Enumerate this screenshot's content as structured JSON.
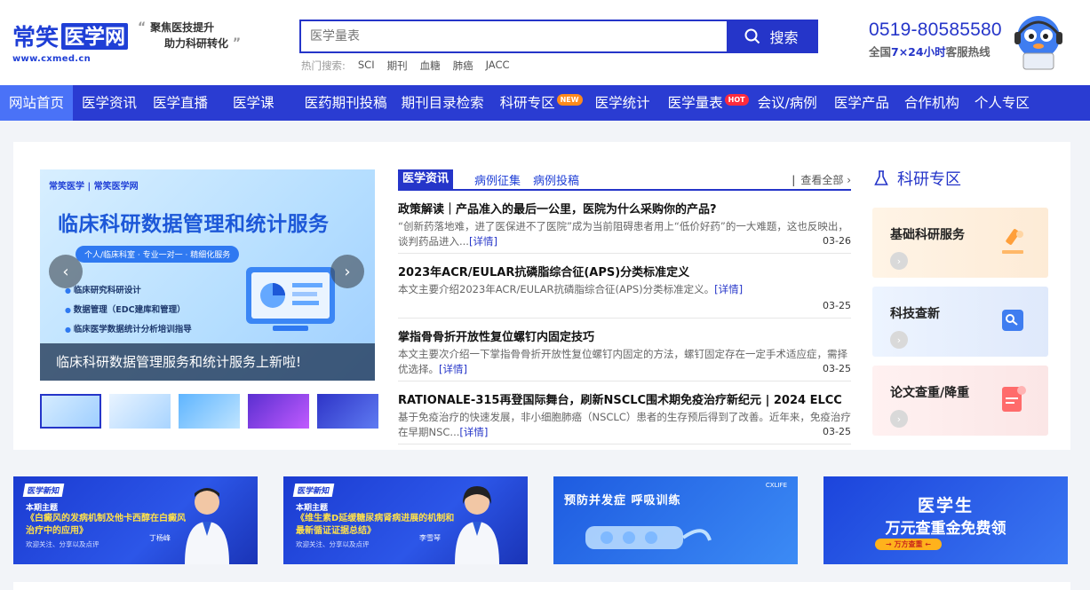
{
  "header": {
    "logo_text_a": "常笑",
    "logo_text_b": "医学网",
    "logo_url": "www.cxmed.cn",
    "slogan_line1": "聚焦医技提升",
    "slogan_line2": "助力科研转化",
    "search_placeholder": "医学量表",
    "search_button": "搜索",
    "hot_label": "热门搜索:",
    "hot_keywords": [
      "SCI",
      "期刊",
      "血糖",
      "肺癌",
      "JACC"
    ],
    "hotline_number": "0519-80585580",
    "hotline_prefix": "全国",
    "hotline_bold": "7×24小时",
    "hotline_suffix": "客服热线"
  },
  "nav": {
    "items": [
      {
        "label": "网站首页"
      },
      {
        "label": "医学资讯"
      },
      {
        "label": "医学直播"
      },
      {
        "label": "医学课"
      },
      {
        "label": "医药期刊投稿"
      },
      {
        "label": "期刊目录检索"
      },
      {
        "label": "科研专区",
        "badge": "NEW"
      },
      {
        "label": "医学统计"
      },
      {
        "label": "医学量表",
        "badge": "HOT"
      },
      {
        "label": "会议/病例"
      },
      {
        "label": "医学产品"
      },
      {
        "label": "合作机构"
      },
      {
        "label": "个人专区"
      }
    ]
  },
  "banner": {
    "logo": "常笑医学 | 常笑医学网",
    "title": "临床科研数据管理和统计服务",
    "pill": "个人/临床科室 · 专业一对一 · 精细化服务",
    "points": [
      "临床研究科研设计",
      "数据管理（EDC建库和管理）",
      "临床医学数据统计分析培训指导"
    ],
    "caption": "临床科研数据管理服务和统计服务上新啦!"
  },
  "news": {
    "tabs": [
      "医学资讯",
      "病例征集",
      "病例投稿"
    ],
    "view_all": "查看全部",
    "more_label": "[详情]",
    "items": [
      {
        "title": "政策解读｜产品准入的最后一公里，医院为什么采购你的产品?",
        "desc": "“创新药落地难，进了医保进不了医院”成为当前阻碍患者用上“低价好药”的一大难题，这也反映出，谈判药品进入...",
        "date": "03-26"
      },
      {
        "title": "2023年ACR/EULAR抗磷脂综合征(APS)分类标准定义",
        "desc": "本文主要介绍2023年ACR/EULAR抗磷脂综合征(APS)分类标准定义。",
        "date": "03-25"
      },
      {
        "title": "掌指骨骨折开放性复位螺钉内固定技巧",
        "desc": "本文主要次介绍一下掌指骨骨折开放性复位螺钉内固定的方法，螺钉固定存在一定手术适应症，需择优选择。",
        "date": "03-25"
      },
      {
        "title": "RATIONALE-315再登国际舞台，刷新NSCLC围术期免疫治疗新纪元 | 2024 ELCC",
        "desc": "基于免疫治疗的快速发展，非小细胞肺癌（NSCLC）患者的生存预后得到了改善。近年来，免疫治疗在早期NSC...",
        "date": "03-25"
      }
    ]
  },
  "side": {
    "title": "科研专区",
    "cards": [
      {
        "label": "基础科研服务"
      },
      {
        "label": "科技查新"
      },
      {
        "label": "论文查重/降重"
      }
    ]
  },
  "ads": {
    "a1": {
      "tag": "医学新知",
      "sub": "本期主题",
      "topic": "《白癜风的发病机制及他卡西醇在白癜风治疗中的应用》",
      "foot": "欢迎关注、分享以及点评",
      "doc": "丁杨峰"
    },
    "a2": {
      "tag": "医学新知",
      "sub": "本期主题",
      "topic": "《维生素D延缓糖尿病肾病进展的机制和最新循证证据总结》",
      "foot": "欢迎关注、分享以及点评",
      "doc": "李雪琴"
    },
    "a3": {
      "title": "预防并发症 呼吸训练",
      "logo": "CXLIFE"
    },
    "a4": {
      "line1": "医学生",
      "line2": "万元查重金免费领",
      "btn": "→ 万方查重 ←"
    }
  },
  "colors": {
    "brand": "#2535c9",
    "nav_bg": "#2a3cd2",
    "nav_active": "#4a72f7",
    "badge_new": "#ff8a1c",
    "badge_hot": "#ff2b3d"
  }
}
